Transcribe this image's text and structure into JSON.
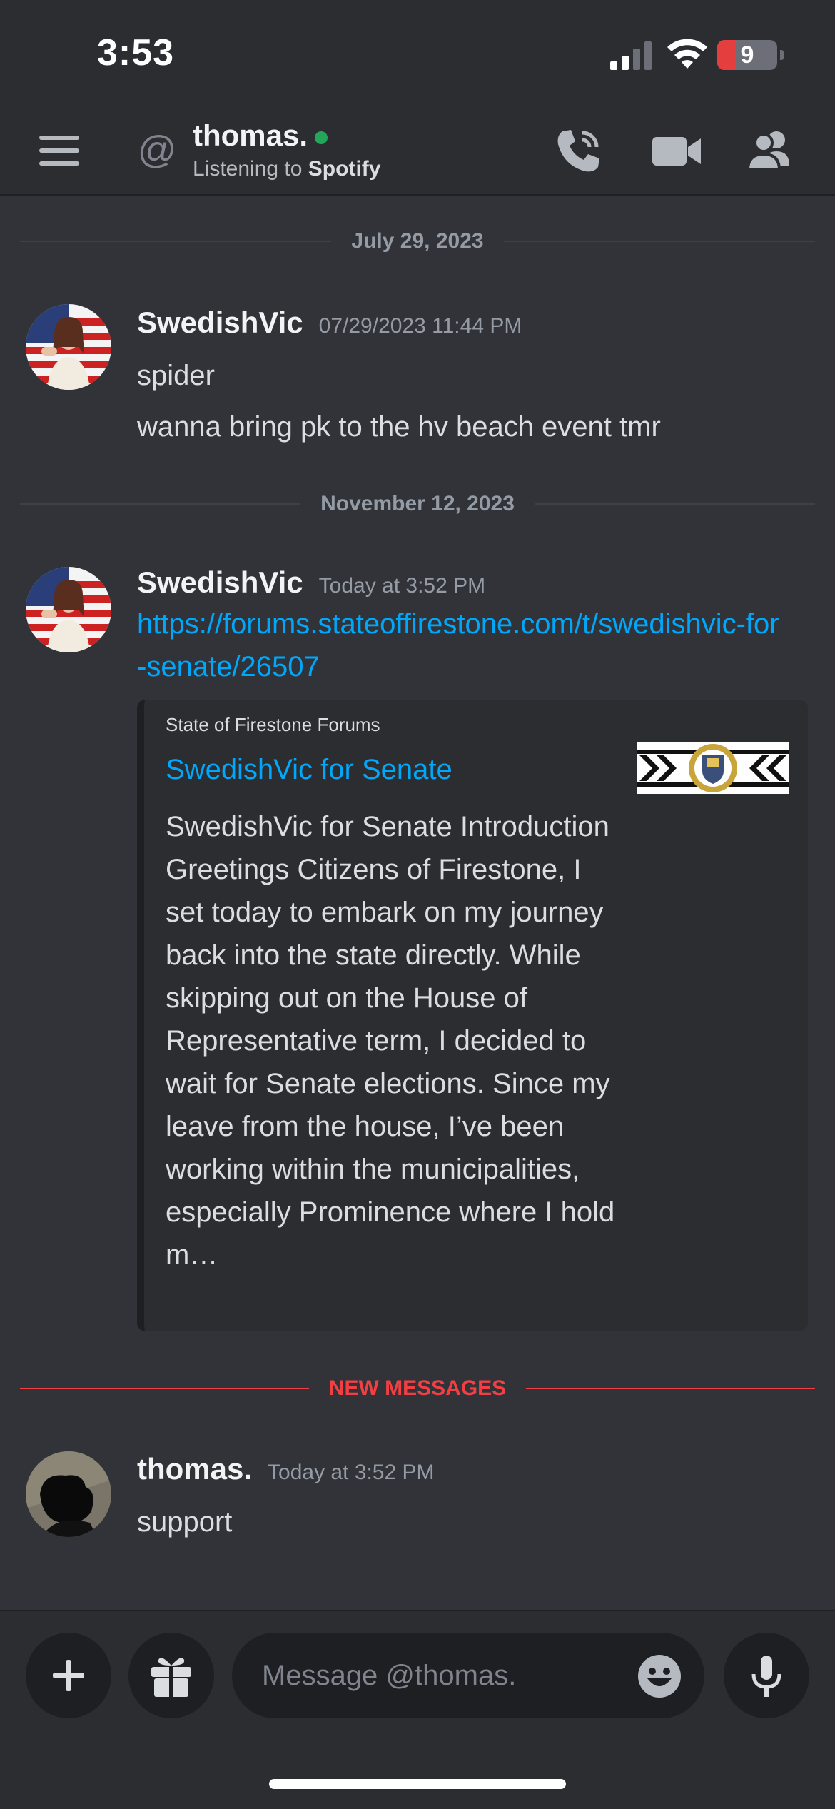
{
  "status_bar": {
    "time": "3:53",
    "battery": "9"
  },
  "header": {
    "username": "thomas.",
    "activity_prefix": "Listening to",
    "activity_app": "Spotify"
  },
  "dividers": {
    "date1": "July 29, 2023",
    "date2": "November 12, 2023",
    "new_messages": "NEW MESSAGES"
  },
  "messages": [
    {
      "author": "SwedishVic",
      "timestamp": "07/29/2023 11:44 PM",
      "lines": [
        "spider",
        "wanna bring pk to the hv beach event tmr"
      ]
    },
    {
      "author": "SwedishVic",
      "timestamp": "Today at 3:52 PM",
      "link": "https://forums.stateoffirestone.com/t/swedishvic-for-senate/26507",
      "embed": {
        "provider": "State of Firestone Forums",
        "title": "SwedishVic for Senate",
        "description": "SwedishVic for Senate Introduction  Greetings Citizens of Firestone,  I set today to embark on my journey back into the state directly. While skipping out on the House of Representative term, I decided to wait for Senate elections. Since my leave from the house, I’ve been working within the municipalities, especially Prominence where I hold m…"
      }
    },
    {
      "author": "thomas.",
      "timestamp": "Today at 3:52 PM",
      "lines": [
        "support"
      ]
    }
  ],
  "composer": {
    "placeholder": "Message @thomas."
  },
  "colors": {
    "background": "#313338",
    "bar": "#2b2d31",
    "link": "#00a8fc",
    "online": "#23a55a",
    "new_messages": "#f23f43"
  },
  "icons": [
    "hamburger-icon",
    "at-icon",
    "phone-icon",
    "video-camera-icon",
    "members-icon",
    "plus-icon",
    "gift-icon",
    "emoji-icon",
    "microphone-icon"
  ]
}
